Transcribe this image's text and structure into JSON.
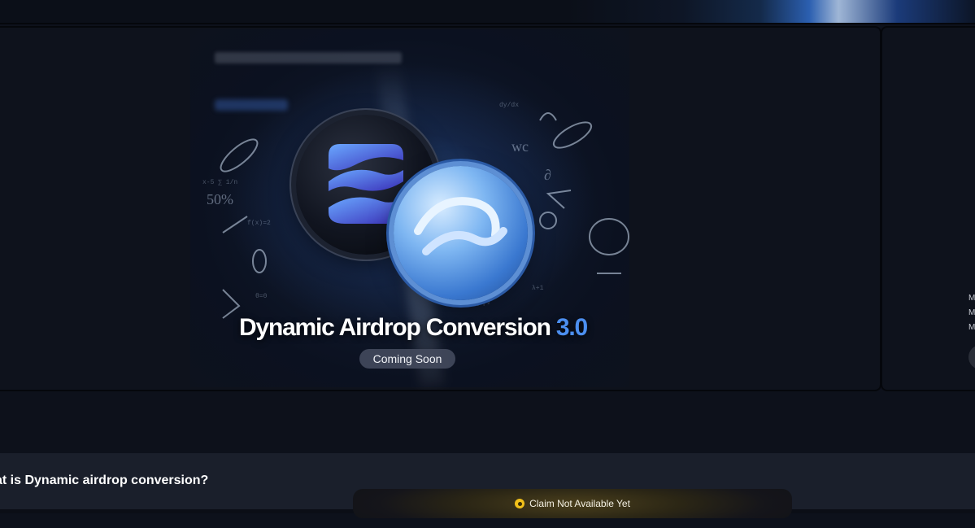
{
  "hero": {
    "title_main": "Dynamic Airdrop Conversion ",
    "title_version": "3.0",
    "badge": "Coming Soon"
  },
  "side_card": {
    "lines": [
      "M",
      "M",
      "M"
    ]
  },
  "faq": {
    "question": "at is Dynamic airdrop conversion?"
  },
  "toast": {
    "message": "Claim Not Available Yet",
    "icon": "coin-icon"
  },
  "colors": {
    "background": "#0d111b",
    "accent_blue": "#4c8ff0",
    "toast_icon": "#f2c11a"
  }
}
